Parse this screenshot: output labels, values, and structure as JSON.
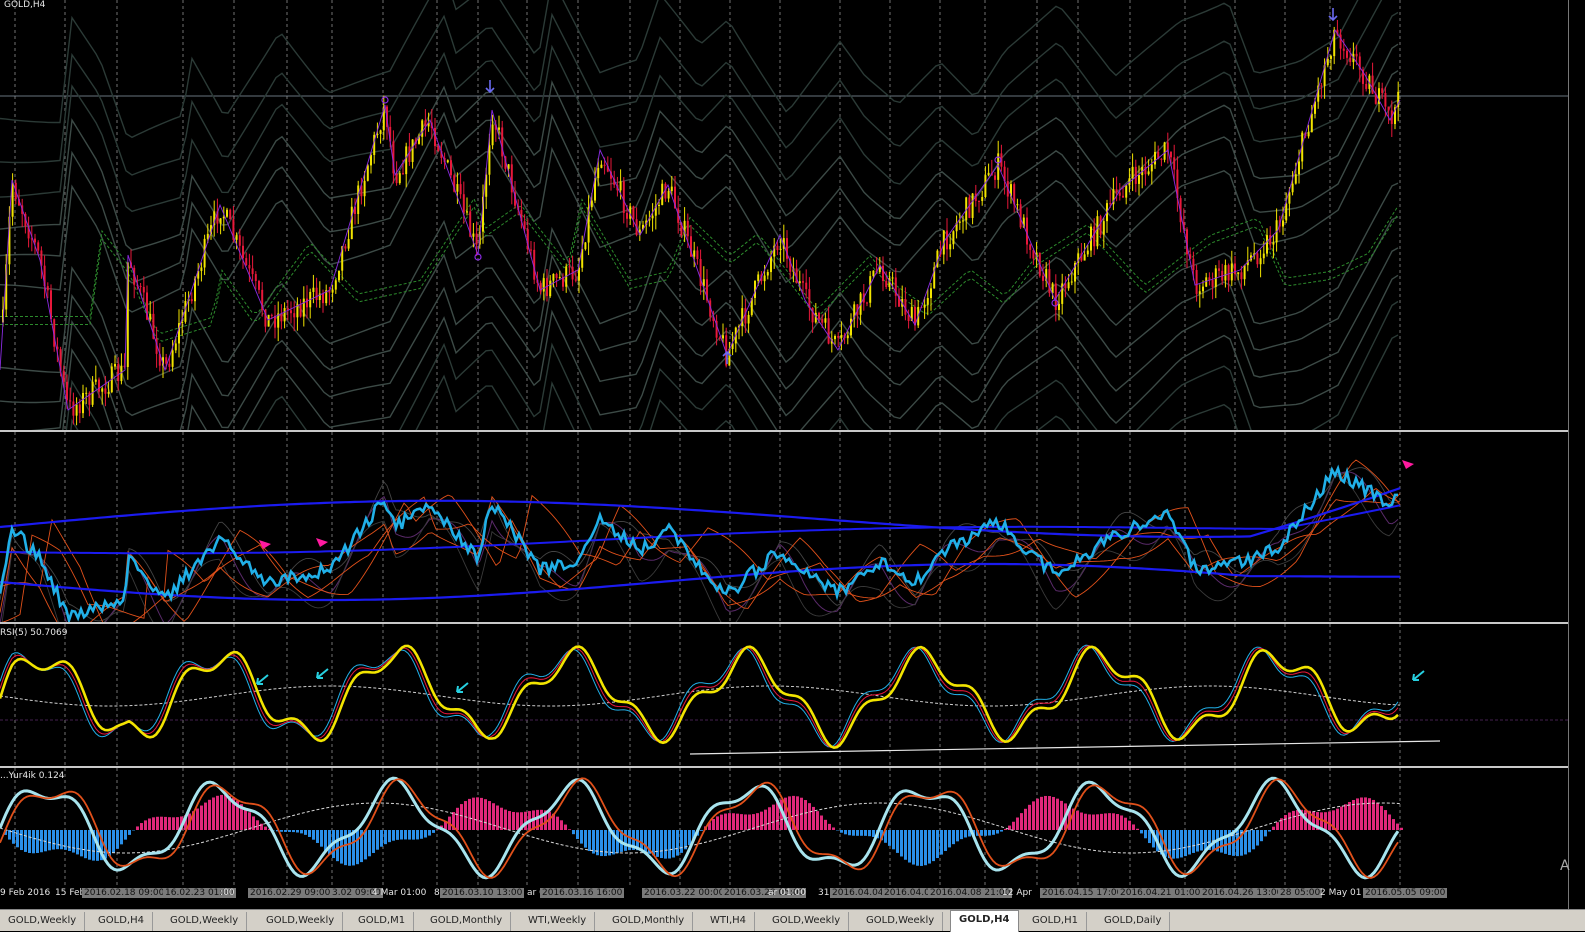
{
  "window": {
    "symbol_label": "GOLD,H4",
    "rsi_label": "RSI(5) 50.7069",
    "macd_label": "...Yur4ik 0.124",
    "watermark": "A"
  },
  "colors": {
    "bull": "#f2e400",
    "bear": "#e8183a",
    "cyan": "#21b0e8",
    "blue": "#1b1bf0",
    "orange": "#e0501a",
    "purple": "#8a2be2",
    "magenta": "#ff1aa0",
    "hist_pos": "#e0287a",
    "hist_neg": "#2a8fe8",
    "lightblue": "#a8e4ee"
  },
  "time_axis": [
    {
      "text": "9 Feb 2016",
      "hl": false
    },
    {
      "text": "15 Feb",
      "hl": false
    },
    {
      "text": "2016.02.18 09:00",
      "hl": true
    },
    {
      "text": "16.02.23 01:00",
      "hl": true
    },
    {
      "text": ":00",
      "hl": false
    },
    {
      "text": "2016.02.29 09:00",
      "hl": true
    },
    {
      "text": "3.02 09:00",
      "hl": true
    },
    {
      "text": "4 Mar 01:00",
      "hl": false
    },
    {
      "text": "8",
      "hl": false
    },
    {
      "text": "2016.03.10 13:00",
      "hl": true
    },
    {
      "text": "ar 09",
      "hl": false
    },
    {
      "text": "2016.03.16 16:00",
      "hl": true
    },
    {
      "text": "2016.03.22 00:00",
      "hl": true
    },
    {
      "text": "2016.03.28 05:00",
      "hl": true
    },
    {
      "text": "ar 01:00",
      "hl": false
    },
    {
      "text": "31",
      "hl": false
    },
    {
      "text": "2016.04.04",
      "hl": true
    },
    {
      "text": "2016.04.0",
      "hl": true
    },
    {
      "text": "2016.04.08 21:00",
      "hl": true
    },
    {
      "text": "12 Apr",
      "hl": false
    },
    {
      "text": "2016.04.15 17:00",
      "hl": true
    },
    {
      "text": "2016.04.21 01:00",
      "hl": true
    },
    {
      "text": "2016.04.26 13:00",
      "hl": true
    },
    {
      "text": "28 05:00",
      "hl": true
    },
    {
      "text": "2 May 01",
      "hl": false
    },
    {
      "text": "2016.05.05 09:00",
      "hl": true
    }
  ],
  "tabs": [
    {
      "label": "GOLD,Weekly",
      "active": false
    },
    {
      "label": "GOLD,H4",
      "active": false
    },
    {
      "label": "GOLD,Weekly",
      "active": false
    },
    {
      "label": "GOLD,Weekly",
      "active": false
    },
    {
      "label": "GOLD,M1",
      "active": false
    },
    {
      "label": "GOLD,Monthly",
      "active": false
    },
    {
      "label": "WTI,Weekly",
      "active": false
    },
    {
      "label": "GOLD,Monthly",
      "active": false
    },
    {
      "label": "WTI,H4",
      "active": false
    },
    {
      "label": "GOLD,Weekly",
      "active": false
    },
    {
      "label": "GOLD,Weekly",
      "active": false
    },
    {
      "label": "GOLD,H4",
      "active": true
    },
    {
      "label": "GOLD,H1",
      "active": false
    },
    {
      "label": "GOLD,Daily",
      "active": false
    }
  ]
}
